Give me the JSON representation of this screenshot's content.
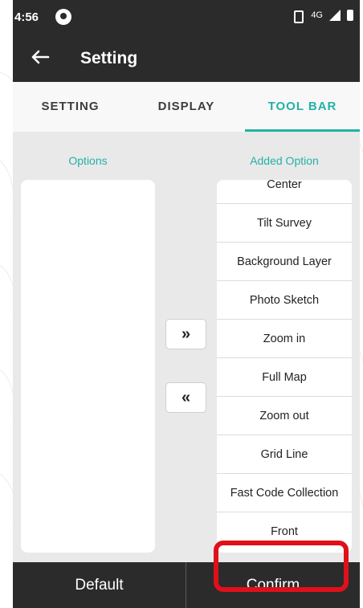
{
  "status_bar": {
    "time": "4:56",
    "network": "4G"
  },
  "app_bar": {
    "title": "Setting"
  },
  "tabs": [
    {
      "label": "SETTING",
      "active": false
    },
    {
      "label": "DISPLAY",
      "active": false
    },
    {
      "label": "TOOL BAR",
      "active": true
    }
  ],
  "options_column": {
    "title": "Options",
    "items": []
  },
  "added_column": {
    "title": "Added Option",
    "items": [
      "Center",
      "Tilt Survey",
      "Background Layer",
      "Photo Sketch",
      "Zoom in",
      "Full Map",
      "Zoom out",
      "Grid Line",
      "Fast Code Collection",
      "Front"
    ],
    "highlighted_item": "Front"
  },
  "transfer_buttons": {
    "add_label": "»",
    "remove_label": "«"
  },
  "bottom_bar": {
    "default_label": "Default",
    "confirm_label": "Confirm"
  },
  "colors": {
    "accent": "#22b2a5",
    "toolbar": "#2b2b2b",
    "highlight": "#e0101b",
    "panel_bg": "#e9e9e9"
  }
}
